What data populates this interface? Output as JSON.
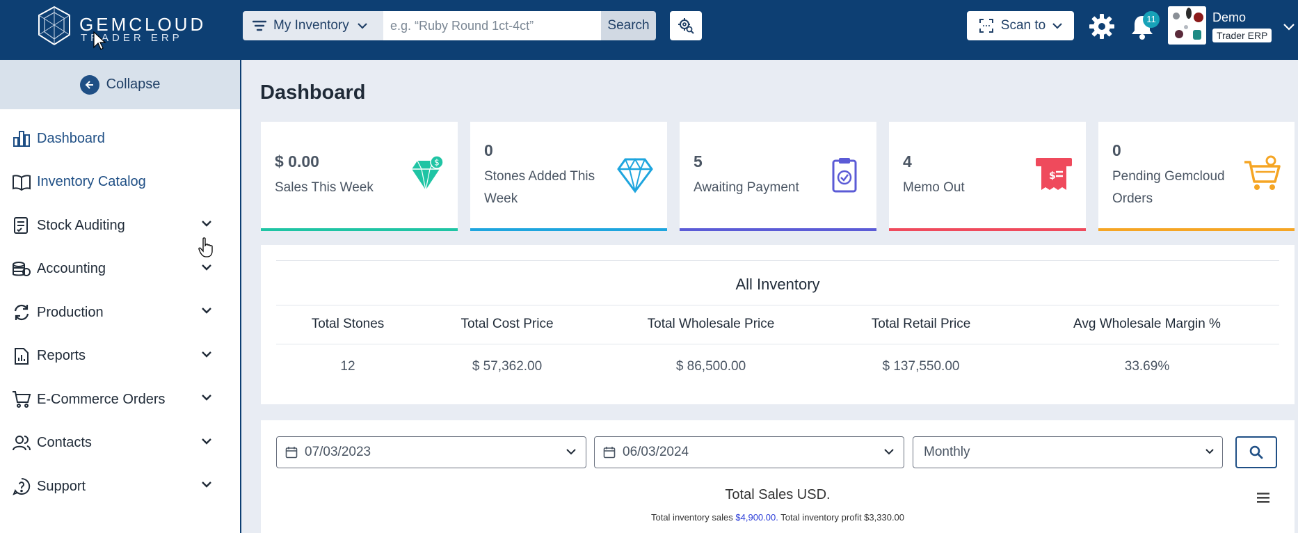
{
  "brand": {
    "name": "GEMCLOUD",
    "subtitle": "TRADER ERP"
  },
  "search": {
    "scope": "My Inventory",
    "placeholder": "e.g. “Ruby Round 1ct-4ct”",
    "button": "Search"
  },
  "header": {
    "scan_label": "Scan to",
    "notification_count": "11",
    "user_name": "Demo",
    "user_role": "Trader ERP"
  },
  "sidebar": {
    "collapse_label": "Collapse",
    "items": [
      {
        "label": "Dashboard",
        "icon": "bar-chart-icon",
        "expandable": false
      },
      {
        "label": "Inventory Catalog",
        "icon": "book-icon",
        "expandable": false
      },
      {
        "label": "Stock Auditing",
        "icon": "checklist-icon",
        "expandable": true
      },
      {
        "label": "Accounting",
        "icon": "coins-icon",
        "expandable": true
      },
      {
        "label": "Production",
        "icon": "refresh-icon",
        "expandable": true
      },
      {
        "label": "Reports",
        "icon": "report-icon",
        "expandable": true
      },
      {
        "label": "E-Commerce Orders",
        "icon": "cart-icon",
        "expandable": true
      },
      {
        "label": "Contacts",
        "icon": "users-icon",
        "expandable": true
      },
      {
        "label": "Support",
        "icon": "help-icon",
        "expandable": true
      }
    ]
  },
  "page": {
    "title": "Dashboard"
  },
  "cards": [
    {
      "value": "$ 0.00",
      "label": "Sales This Week",
      "color": "#1fc4a4",
      "icon": "diamond-dollar-icon"
    },
    {
      "value": "0",
      "label": "Stones Added This Week",
      "color": "#1ea5de",
      "icon": "diamond-icon"
    },
    {
      "value": "5",
      "label": "Awaiting Payment",
      "color": "#5b5bd6",
      "icon": "clipboard-check-icon"
    },
    {
      "value": "4",
      "label": "Memo Out",
      "color": "#ef4a5c",
      "icon": "receipt-icon"
    },
    {
      "value": "0",
      "label": "Pending Gemcloud Orders",
      "color": "#f5a524",
      "icon": "cart-icon"
    }
  ],
  "inventory": {
    "title": "All Inventory",
    "columns": [
      "Total Stones",
      "Total Cost Price",
      "Total Wholesale Price",
      "Total Retail Price",
      "Avg Wholesale Margin %"
    ],
    "values": [
      "12",
      "$ 57,362.00",
      "$ 86,500.00",
      "$ 137,550.00",
      "33.69%"
    ]
  },
  "sales_filter": {
    "start_date": "07/03/2023",
    "end_date": "06/03/2024",
    "period": "Monthly"
  },
  "sales_chart": {
    "title": "Total Sales USD.",
    "sub_prefix": "Total inventory sales",
    "sales_amount": "$4,900.00.",
    "sub_suffix": "Total inventory profit $3,330.00"
  }
}
